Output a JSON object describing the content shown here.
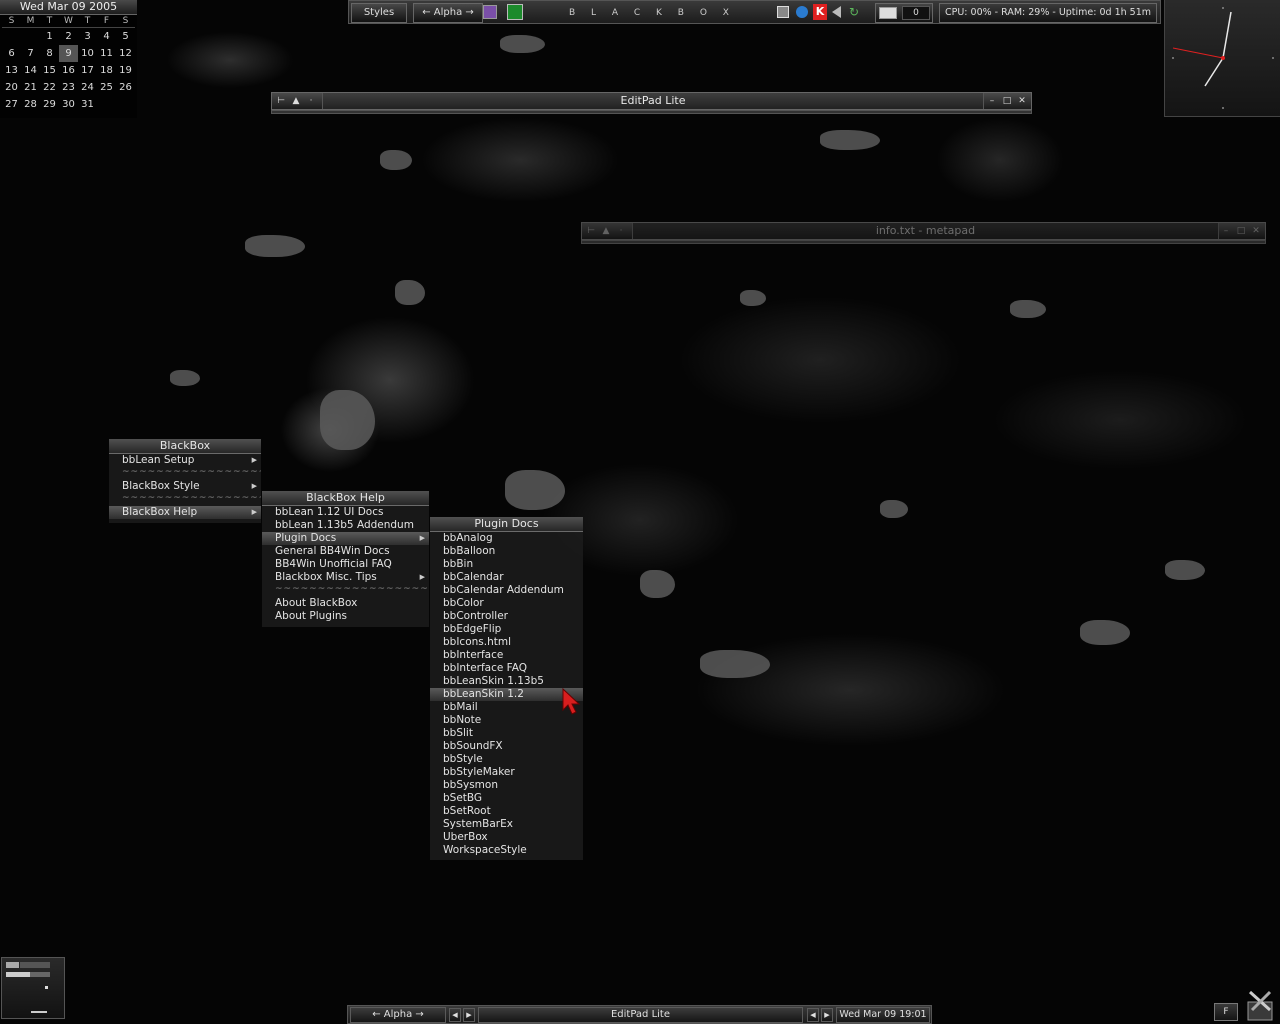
{
  "calendar": {
    "header": "Wed Mar 09  2005",
    "weekdays": [
      "S",
      "M",
      "T",
      "W",
      "T",
      "F",
      "S"
    ],
    "weeks": [
      [
        "",
        "",
        "1",
        "2",
        "3",
        "4",
        "5"
      ],
      [
        "6",
        "7",
        "8",
        "9",
        "10",
        "11",
        "12"
      ],
      [
        "13",
        "14",
        "15",
        "16",
        "17",
        "18",
        "19"
      ],
      [
        "20",
        "21",
        "22",
        "23",
        "24",
        "25",
        "26"
      ],
      [
        "27",
        "28",
        "29",
        "30",
        "31",
        "",
        ""
      ]
    ]
  },
  "toolbar": {
    "styles_label": "Styles",
    "workspace_label": "← Alpha →",
    "brand_letters": [
      "B",
      "L",
      "A",
      "C",
      "K",
      "B",
      "O",
      "X"
    ],
    "mail_count": "0",
    "sysmon": "CPU: 00% - RAM: 29% - Uptime: 0d 1h 51m"
  },
  "windows": {
    "editpad_title": "EditPad Lite",
    "metapad_title": "info.txt - metapad"
  },
  "menus": {
    "blackbox": {
      "title": "BlackBox",
      "items": [
        "bbLean Setup",
        "~~~~~~~~~~~~~~~~~~~",
        "BlackBox Style",
        "~~~~~~~~~~~~~~~~~~~",
        "BlackBox Help"
      ]
    },
    "help": {
      "title": "BlackBox Help",
      "items": [
        "bbLean 1.12 UI Docs",
        "bbLean 1.13b5 Addendum",
        "Plugin Docs",
        "General BB4Win Docs",
        "BB4Win Unofficial FAQ",
        "Blackbox Misc. Tips",
        "~~~~~~~~~~~~~~~~~~~",
        "About BlackBox",
        "About Plugins"
      ]
    },
    "plugins": {
      "title": "Plugin Docs",
      "items": [
        "bbAnalog",
        "bbBalloon",
        "bbBin",
        "bbCalendar",
        "bbCalendar Addendum",
        "bbColor",
        "bbController",
        "bbEdgeFlip",
        "bbIcons.html",
        "bbInterface",
        "bbInterface FAQ",
        "bbLeanSkin 1.13b5",
        "bbLeanSkin 1.2",
        "bbMail",
        "bbNote",
        "bbSlit",
        "bbSoundFX",
        "bbStyle",
        "bbStyleMaker",
        "bbSysmon",
        "bSetBG",
        "bSetRoot",
        "SystemBarEx",
        "UberBox",
        "WorkspaceStyle"
      ]
    }
  },
  "taskbar": {
    "workspace_label": "← Alpha →",
    "task_label": "EditPad Lite",
    "datetime": "Wed Mar 09 19:01",
    "tray_label": "F"
  },
  "colors": {
    "accent_red": "#e02020",
    "cursor_red": "#d81e1e"
  }
}
